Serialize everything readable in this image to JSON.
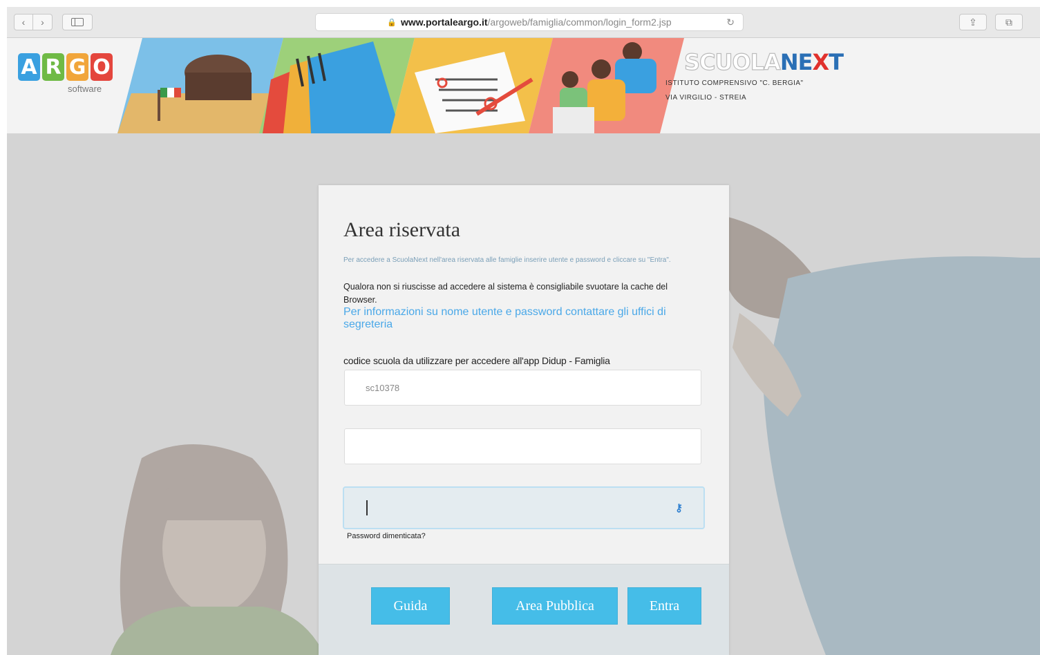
{
  "browser": {
    "url_domain": "www.portaleargo.it",
    "url_path": "/argoweb/famiglia/common/login_form2.jsp",
    "back_icon": "chevron-left-icon",
    "forward_icon": "chevron-right-icon",
    "back_glyph": "‹",
    "forward_glyph": "›",
    "lock_glyph": "🔒",
    "reload_glyph": "↻",
    "share_glyph": "⇪",
    "tabs_glyph": "⧉"
  },
  "header": {
    "logo_letters": [
      "A",
      "R",
      "G",
      "O"
    ],
    "logo_colors": [
      "#3aa0e0",
      "#6fba45",
      "#f1a53a",
      "#e4463d"
    ],
    "logo_sub": "software",
    "brand_scuola": "SCUOLA",
    "brand_ne": "NE",
    "brand_x": "X",
    "brand_t": "T",
    "school_name": "ISTITUTO COMPRENSIVO \"C. BERGIA\"",
    "school_address": "VIA VIRGILIO - STREIA"
  },
  "login": {
    "title": "Area riservata",
    "info_small": "Per accedere a ScuolaNext nell'area riservata alle famiglie inserire utente e password e cliccare su \"Entra\".",
    "info_cache": "Qualora non si riuscisse ad accedere al sistema è consigliabile svuotare la cache del Browser.",
    "info_link": "Per informazioni su nome utente e password contattare gli uffici di segreteria",
    "code_label": "codice scuola da utilizzare per accedere all'app Didup - Famiglia",
    "code_value": "sc10378",
    "username_value": "",
    "password_value": "",
    "key_glyph": "⚷",
    "forgot_label": "Password dimenticata?",
    "buttons": {
      "guida": "Guida",
      "area_pubblica": "Area Pubblica",
      "entra": "Entra"
    }
  },
  "colors": {
    "accent": "#45bde8",
    "link": "#4aa8e8",
    "background": "#d4d4d4"
  }
}
